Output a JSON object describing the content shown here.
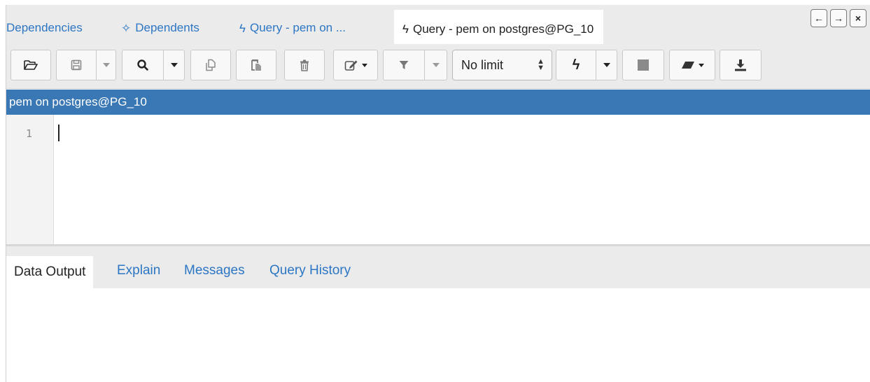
{
  "tabs": [
    {
      "label": "Dependencies",
      "icon": ""
    },
    {
      "label": "Dependents",
      "icon": "dependents-icon"
    },
    {
      "label": "Query - pem on ...",
      "icon": "lightning-icon"
    },
    {
      "label": "Query - pem on postgres@PG_10",
      "icon": "lightning-icon",
      "active": true
    }
  ],
  "tab_icons": {
    "dependents": "✧",
    "lightning": "ϟ"
  },
  "nav_buttons": {
    "back": "←",
    "forward": "→",
    "close": "×"
  },
  "toolbar": {
    "open": "open-file-icon",
    "save": "save-icon",
    "find": "search-icon",
    "copy": "copy-icon",
    "paste": "paste-icon",
    "delete": "delete-icon",
    "edit": "edit-icon",
    "filter": "filter-icon",
    "limit_value": "No limit",
    "execute": "lightning-icon",
    "stop": "stop-icon",
    "clear": "eraser-icon",
    "download": "download-icon"
  },
  "connection": {
    "label": "pem on postgres@PG_10"
  },
  "editor": {
    "line_numbers": [
      "1"
    ]
  },
  "output_tabs": [
    {
      "label": "Data Output",
      "active": true
    },
    {
      "label": "Explain"
    },
    {
      "label": "Messages"
    },
    {
      "label": "Query History"
    }
  ],
  "colors": {
    "accent_blue": "#3a77b5",
    "link_blue": "#2c76c4",
    "panel_gray": "#ebebeb"
  }
}
